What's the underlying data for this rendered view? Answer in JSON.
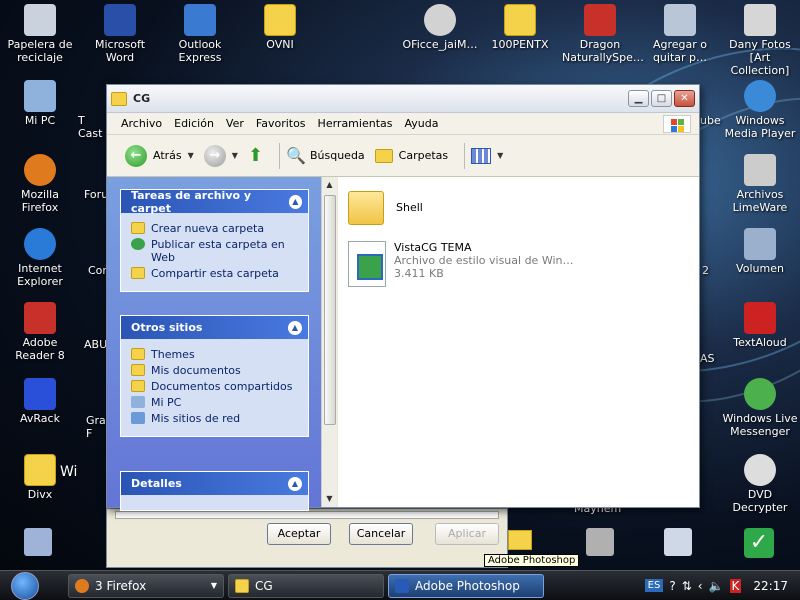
{
  "desktop": {
    "icons": [
      {
        "label": "Papelera de reciclaje",
        "color": "#c9d2dd"
      },
      {
        "label": "Microsoft Word",
        "color": "#2a4fa8"
      },
      {
        "label": "Outlook Express",
        "color": "#3a7ad0"
      },
      {
        "label": "OVNI",
        "color": "#f4d24a"
      },
      {
        "label": "OFicce_jaiM…",
        "color": "#d2d2d2"
      },
      {
        "label": "100PENTX",
        "color": "#f4d24a"
      },
      {
        "label": "Dragon NaturallySpe…",
        "color": "#c8302a"
      },
      {
        "label": "Agregar o quitar p…",
        "color": "#b9c6d8"
      },
      {
        "label": "Dany Fotos [Art Collection]",
        "color": "#d6d6d6"
      },
      {
        "label": "Mi PC",
        "color": "#8fb2dd"
      },
      {
        "label": "Windows Media Player",
        "color": "#3a8ad8"
      },
      {
        "label": "Mozilla Firefox",
        "color": "#e07a1f"
      },
      {
        "label": "Archivos LimeWare",
        "color": "#ccc"
      },
      {
        "label": "Internet Explorer",
        "color": "#2a7ad8"
      },
      {
        "label": "Volumen",
        "color": "#9ab0cc"
      },
      {
        "label": "Adobe Reader 8",
        "color": "#c8302a"
      },
      {
        "label": "TextAloud",
        "color": "#cc2222"
      },
      {
        "label": "AvRack",
        "color": "#2a4fd8"
      },
      {
        "label": "Windows Live Messenger",
        "color": "#4cb04c"
      },
      {
        "label": "Divx",
        "color": "#f4d24a"
      },
      {
        "label": "DVD Decrypter",
        "color": "#ddd"
      }
    ],
    "partial_labels": {
      "t1": "T",
      "t2": "Cast",
      "t3": "Foru",
      "t4": "Con",
      "t5": "ABU",
      "t6": "Gra",
      "t7": "F",
      "t8": "ube",
      "t9": "2",
      "t10": "AS",
      "t11": "Wi",
      "t12": "Mayhem"
    }
  },
  "window": {
    "title": "CG",
    "menu": [
      "Archivo",
      "Edición",
      "Ver",
      "Favoritos",
      "Herramientas",
      "Ayuda"
    ],
    "toolbar": {
      "back": "Atrás",
      "search": "Búsqueda",
      "folders": "Carpetas"
    },
    "tasks_panel": {
      "title": "Tareas de archivo y carpet",
      "items": [
        "Crear nueva carpeta",
        "Publicar esta carpeta en Web",
        "Compartir esta carpeta"
      ]
    },
    "other_places": {
      "title": "Otros sitios",
      "items": [
        "Themes",
        "Mis documentos",
        "Documentos compartidos",
        "Mi PC",
        "Mis sitios de red"
      ]
    },
    "details": {
      "title": "Detalles"
    },
    "files": [
      {
        "name": "Shell",
        "type": "",
        "size": ""
      },
      {
        "name": "VistaCG TEMA",
        "type": "Archivo de estilo visual de Win…",
        "size": "3.411 KB"
      }
    ]
  },
  "dialog": {
    "ok": "Aceptar",
    "cancel": "Cancelar",
    "apply": "Aplicar"
  },
  "tooltip": "Adobe Photoshop",
  "taskbar": {
    "tasks": [
      {
        "label": "3 Firefox"
      },
      {
        "label": "CG"
      },
      {
        "label": "Adobe Photoshop"
      }
    ],
    "lang": "ES",
    "clock": "22:17"
  }
}
